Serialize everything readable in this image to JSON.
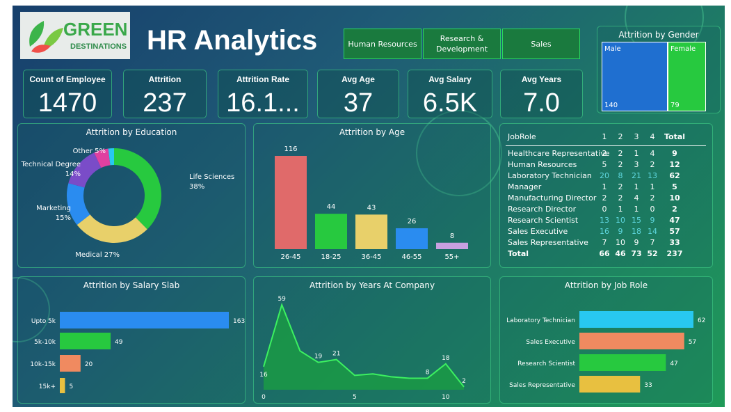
{
  "header": {
    "logo_text": "GREEN",
    "logo_sub": "DESTINATIONS",
    "title": "HR Analytics"
  },
  "slicers": [
    {
      "label": "Human Resources"
    },
    {
      "label": "Research &\nDevelopment"
    },
    {
      "label": "Sales"
    }
  ],
  "kpis": [
    {
      "label": "Count of Employee",
      "value": "1470"
    },
    {
      "label": "Attrition",
      "value": "237"
    },
    {
      "label": "Attrition Rate",
      "value": "16.1..."
    },
    {
      "label": "Avg Age",
      "value": "37"
    },
    {
      "label": "Avg Salary",
      "value": "6.5K"
    },
    {
      "label": "Avg Years",
      "value": "7.0"
    }
  ],
  "colors": {
    "blue": "#1f6fd0",
    "green": "#27c93f",
    "purple": "#7a4cc8",
    "pink": "#e040a0",
    "red": "#e06a6a",
    "yellow": "#e8d06a",
    "lightblue": "#2a8cf0",
    "lilac": "#c8a0e0",
    "cyan": "#28c8f0",
    "salmon": "#f08a60",
    "mustard": "#e8c040"
  },
  "chart_data": [
    {
      "id": "gender",
      "type": "treemap",
      "title": "Attrition by Gender",
      "categories": [
        "Male",
        "Female"
      ],
      "values": [
        140,
        79
      ]
    },
    {
      "id": "education",
      "type": "pie",
      "title": "Attrition by Education",
      "slices": [
        {
          "label": "Life Sciences",
          "pct": "38%",
          "value": 38
        },
        {
          "label": "Medical",
          "pct": "27%",
          "value": 27
        },
        {
          "label": "Marketing",
          "pct": "15%",
          "value": 15
        },
        {
          "label": "Technical Degree",
          "pct": "14%",
          "value": 14
        },
        {
          "label": "Other",
          "pct": "5%",
          "value": 5
        },
        {
          "label": "",
          "pct": "",
          "value": 2
        }
      ]
    },
    {
      "id": "age",
      "type": "bar",
      "title": "Attrition by Age",
      "categories": [
        "26-45",
        "18-25",
        "36-45",
        "46-55",
        "55+"
      ],
      "values": [
        116,
        44,
        43,
        26,
        8
      ]
    },
    {
      "id": "jobrole_matrix",
      "type": "table",
      "columns": [
        "JobRole",
        "1",
        "2",
        "3",
        "4",
        "Total"
      ],
      "rows": [
        [
          "Healthcare Representative",
          "2",
          "2",
          "1",
          "4",
          "9"
        ],
        [
          "Human Resources",
          "5",
          "2",
          "3",
          "2",
          "12"
        ],
        [
          "Laboratory Technician",
          "20",
          "8",
          "21",
          "13",
          "62"
        ],
        [
          "Manager",
          "1",
          "2",
          "1",
          "1",
          "5"
        ],
        [
          "Manufacturing Director",
          "2",
          "2",
          "4",
          "2",
          "10"
        ],
        [
          "Research Director",
          "0",
          "1",
          "1",
          "0",
          "2"
        ],
        [
          "Research Scientist",
          "13",
          "10",
          "15",
          "9",
          "47"
        ],
        [
          "Sales Executive",
          "16",
          "9",
          "18",
          "14",
          "57"
        ],
        [
          "Sales Representative",
          "7",
          "10",
          "9",
          "7",
          "33"
        ]
      ],
      "total": [
        "Total",
        "66",
        "46",
        "73",
        "52",
        "237"
      ]
    },
    {
      "id": "salary",
      "type": "bar",
      "title": "Attrition by Salary Slab",
      "orientation": "horizontal",
      "categories": [
        "Upto 5k",
        "5k-10k",
        "10k-15k",
        "15k+"
      ],
      "values": [
        163,
        49,
        20,
        5
      ]
    },
    {
      "id": "years",
      "type": "area",
      "title": "Attrition by Years At Company",
      "x": [
        0,
        1,
        2,
        3,
        4,
        5,
        6,
        7,
        8,
        9,
        10,
        11
      ],
      "y": [
        16,
        59,
        27,
        19,
        21,
        10,
        11,
        9,
        8,
        8,
        18,
        2
      ],
      "labeled": [
        {
          "x": 0,
          "y": 16
        },
        {
          "x": 1,
          "y": 59
        },
        {
          "x": 3,
          "y": 19
        },
        {
          "x": 4,
          "y": 21
        },
        {
          "x": 9,
          "y": 8
        },
        {
          "x": 10,
          "y": 18
        },
        {
          "x": 11,
          "y": 2
        }
      ],
      "xticks": [
        0,
        5,
        10
      ]
    },
    {
      "id": "jobrole_bar",
      "type": "bar",
      "title": "Attrition by Job Role",
      "orientation": "horizontal",
      "categories": [
        "Laboratory Technician",
        "Sales Executive",
        "Research Scientist",
        "Sales Representative"
      ],
      "values": [
        62,
        57,
        47,
        33
      ]
    }
  ]
}
